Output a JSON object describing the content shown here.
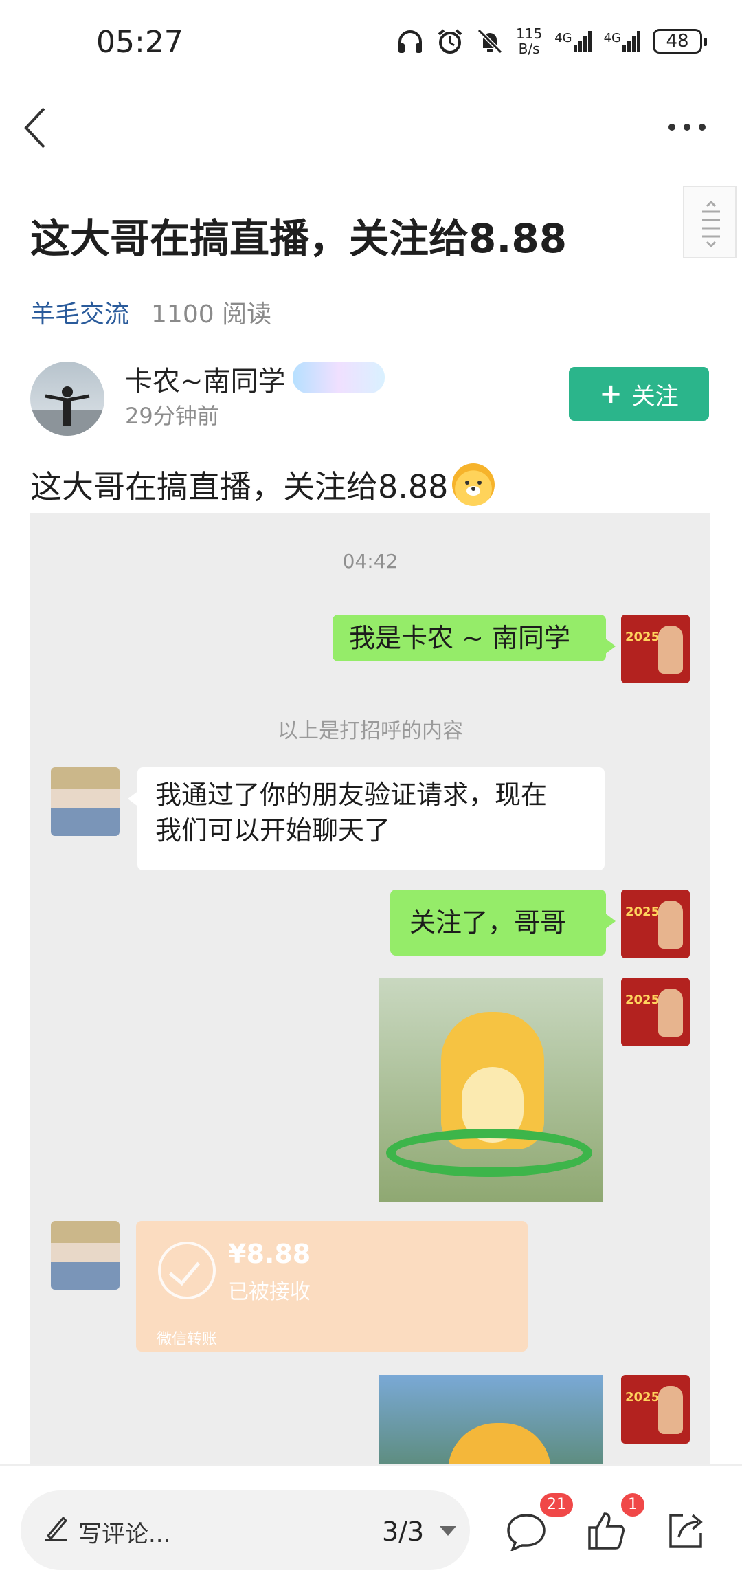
{
  "status_bar": {
    "time": "05:27",
    "net_speed_value": "115",
    "net_speed_unit": "B/s",
    "signal_1": "4G",
    "signal_2": "4G",
    "battery": "48",
    "icons": [
      "headphones-icon",
      "alarm-icon",
      "mute-icon",
      "signal-icon",
      "signal-icon",
      "battery-icon"
    ]
  },
  "nav": {
    "back_icon": "chevron-left-icon",
    "more_icon": "more-dots-icon"
  },
  "post": {
    "title": "这大哥在搞直播，关注给8.88",
    "category": "羊毛交流",
    "reads": "1100 阅读",
    "author": {
      "name": "卡农~南同学",
      "time": "29分钟前"
    },
    "follow_label": "关注",
    "body_text": "这大哥在搞直播，关注给8.88"
  },
  "chat": {
    "time": "04:42",
    "messages": [
      {
        "side": "right",
        "type": "text",
        "text": "我是卡农 ~ 南同学"
      },
      {
        "side": "system",
        "type": "system",
        "text": "以上是打招呼的内容"
      },
      {
        "side": "left",
        "type": "text",
        "lines": [
          "我通过了你的朋友验证请求，现在",
          "我们可以开始聊天了"
        ]
      },
      {
        "side": "right",
        "type": "text",
        "text": "关注了，哥哥"
      },
      {
        "side": "right",
        "type": "sticker"
      },
      {
        "side": "left",
        "type": "transfer",
        "amount": "¥8.88",
        "status": "已被接收",
        "kind": "微信转账"
      },
      {
        "side": "right",
        "type": "sticker"
      }
    ],
    "my_avatar_year": "2025"
  },
  "bottom_bar": {
    "comment_placeholder": "写评论...",
    "pager": "3/3",
    "comment_count": "21",
    "like_count": "1"
  },
  "colors": {
    "follow_green": "#2bb58b",
    "category_blue": "#2a5b9b",
    "chat_green": "#95ec69",
    "badge_red": "#f04848"
  }
}
